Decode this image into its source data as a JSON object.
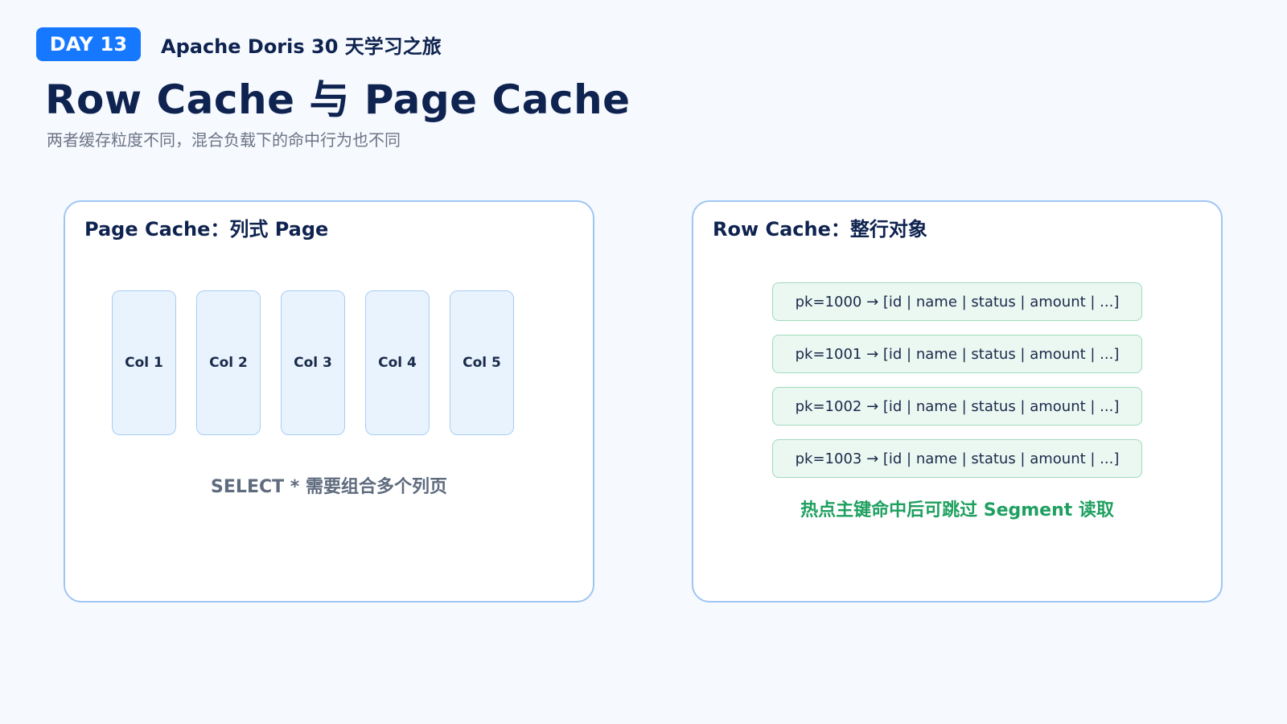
{
  "header": {
    "day_badge": "DAY 13",
    "series_title": "Apache Doris 30 天学习之旅",
    "title": "Row Cache 与 Page Cache",
    "subtitle": "两者缓存粒度不同，混合负载下的命中行为也不同"
  },
  "left_panel": {
    "title": "Page Cache：列式 Page",
    "columns": [
      "Col 1",
      "Col 2",
      "Col 3",
      "Col 4",
      "Col 5"
    ],
    "note": "SELECT * 需要组合多个列页"
  },
  "right_panel": {
    "title": "Row Cache：整行对象",
    "rows": [
      "pk=1000 → [id | name | status | amount | ...]",
      "pk=1001 → [id | name | status | amount | ...]",
      "pk=1002 → [id | name | status | amount | ...]",
      "pk=1003 → [id | name | status | amount | ...]"
    ],
    "note": "热点主键命中后可跳过 Segment 读取"
  },
  "colors": {
    "badge": "#1677ff",
    "background": "#f6f9fe",
    "panel_border": "#9fc5f5",
    "column_fill": "#e9f3fd",
    "row_fill": "#ebf7f1",
    "row_border": "#9fdcbd",
    "accent_green": "#1fa060",
    "title_text": "#0f2350",
    "muted_text": "#6c7485"
  }
}
